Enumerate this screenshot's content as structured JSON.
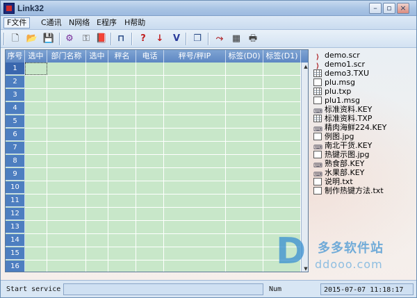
{
  "window": {
    "title": "Link32"
  },
  "window_buttons": {
    "minimize": "–",
    "restore": "▫",
    "close": "×"
  },
  "menu": [
    {
      "label": "F文件"
    },
    {
      "label": "C通讯"
    },
    {
      "label": "N网络"
    },
    {
      "label": "E程序"
    },
    {
      "label": "H帮助"
    }
  ],
  "toolbar": {
    "buttons": [
      {
        "icon": "new-file-icon",
        "glyph": "🗋"
      },
      {
        "icon": "open-folder-icon",
        "glyph": "📂"
      },
      {
        "icon": "save-icon",
        "glyph": "💾"
      },
      {
        "icon": "gear-icon",
        "glyph": "⚙"
      },
      {
        "icon": "key-icon",
        "glyph": "⚿"
      },
      {
        "icon": "book-icon",
        "glyph": "📕"
      },
      {
        "icon": "device-icon",
        "glyph": "⊓"
      },
      {
        "icon": "query-icon",
        "glyph": "?"
      },
      {
        "icon": "download-arrow-icon",
        "glyph": "↓"
      },
      {
        "icon": "checkmark-icon",
        "glyph": "V"
      },
      {
        "icon": "copy-icon",
        "glyph": "❐"
      },
      {
        "icon": "send-icon",
        "glyph": "⤳"
      },
      {
        "icon": "table-icon",
        "glyph": "▦"
      },
      {
        "icon": "print-icon",
        "glyph": "🖶"
      }
    ]
  },
  "grid": {
    "columns": [
      "序号",
      "选中",
      "部门名称",
      "选中",
      "秤名",
      "电话",
      "秤号/秤IP",
      "标签(D0)",
      "标签(D1)"
    ],
    "row_numbers": [
      "1",
      "2",
      "3",
      "4",
      "5",
      "6",
      "7",
      "8",
      "9",
      "10",
      "11",
      "12",
      "13",
      "14",
      "15",
      "16"
    ]
  },
  "files": [
    {
      "name": "demo.scr",
      "type": "scr"
    },
    {
      "name": "demo1.scr",
      "type": "scr"
    },
    {
      "name": "demo3.TXU",
      "type": "grid"
    },
    {
      "name": "plu.msg",
      "type": "doc"
    },
    {
      "name": "plu.txp",
      "type": "grid"
    },
    {
      "name": "plu1.msg",
      "type": "doc"
    },
    {
      "name": "标准资料.KEY",
      "type": "key"
    },
    {
      "name": "标准资料.TXP",
      "type": "grid"
    },
    {
      "name": "精肉海鲜224.KEY",
      "type": "key"
    },
    {
      "name": "例图.jpg",
      "type": "doc"
    },
    {
      "name": "南北干货.KEY",
      "type": "key"
    },
    {
      "name": "热键示图.jpg",
      "type": "doc"
    },
    {
      "name": "熟食部.KEY",
      "type": "key"
    },
    {
      "name": "水果部.KEY",
      "type": "key"
    },
    {
      "name": "说明.txt",
      "type": "doc"
    },
    {
      "name": "制作热键方法.txt",
      "type": "doc"
    }
  ],
  "watermark": {
    "logo": "D",
    "name": "多多软件站",
    "url": "ddooo.com"
  },
  "status": {
    "message": "Start service",
    "mode": "Num",
    "datetime": "2015-07-07 11:18:17"
  },
  "colors": {
    "grid_bg": "#c8e7c9",
    "header_bg": "#5d87c3",
    "rownum_bg": "#4d7ec0"
  }
}
